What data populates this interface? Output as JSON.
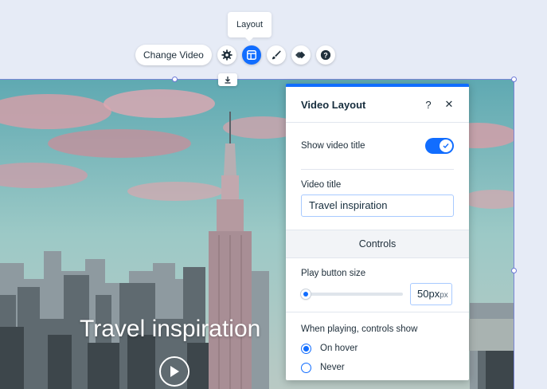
{
  "tooltip": {
    "text": "Layout"
  },
  "toolbar": {
    "change_video_label": "Change Video",
    "icons": [
      "settings-gear-icon",
      "layout-icon",
      "paint-brush-icon",
      "animation-icon",
      "help-icon"
    ]
  },
  "video": {
    "title": "Travel inspiration"
  },
  "panel": {
    "title": "Video Layout",
    "help_label": "?",
    "close_label": "✕",
    "show_title_label": "Show video title",
    "show_title_on": true,
    "video_title_label": "Video title",
    "video_title_value": "Travel inspiration",
    "controls_section": "Controls",
    "play_size_label": "Play button size",
    "play_size_value": "50px",
    "play_size_unit": "px",
    "controls_show_label": "When playing, controls show",
    "radio_options": [
      {
        "label": "On hover",
        "checked": true
      },
      {
        "label": "Never",
        "checked": false
      }
    ]
  },
  "colors": {
    "accent": "#116dff",
    "canvas_bg": "#e6ebf6",
    "selection": "#7a86d6"
  }
}
